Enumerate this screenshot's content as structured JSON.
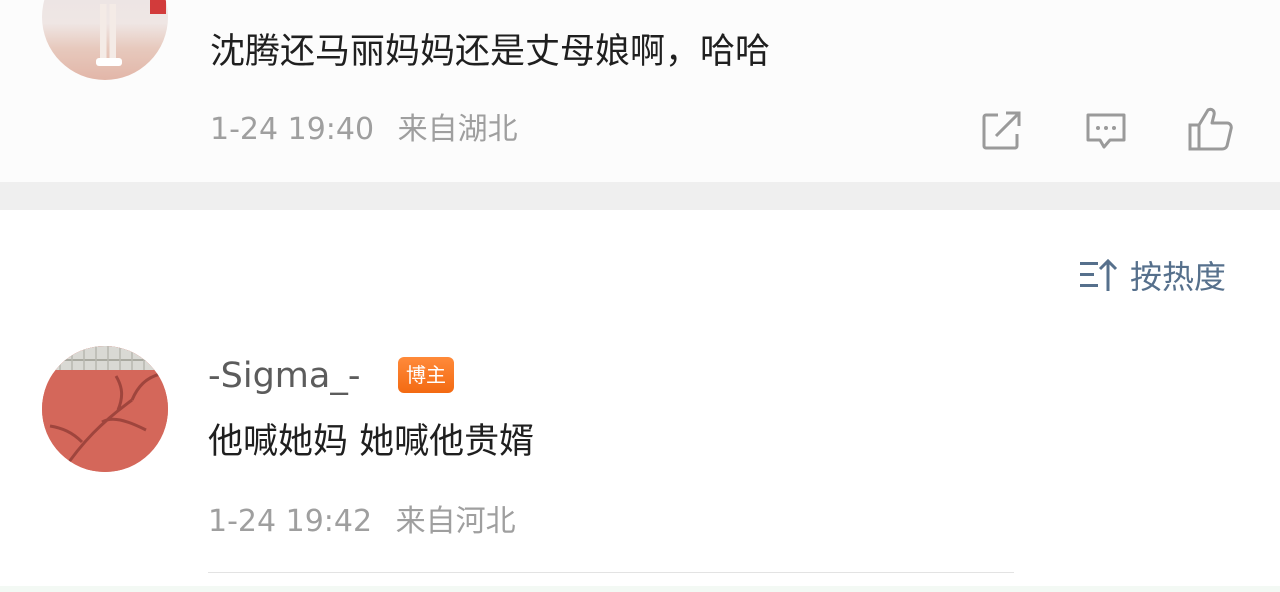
{
  "comment_top": {
    "text": "沈腾还马丽妈妈还是丈母娘啊，哈哈",
    "time": "1-24 19:40",
    "location": "来自湖北",
    "actions": {
      "share": "share-icon",
      "comment": "comment-icon",
      "like": "thumbs-up-icon"
    }
  },
  "sort": {
    "label": "按热度"
  },
  "comment_second": {
    "username": "-Sigma_-",
    "badge": "博主",
    "text": "他喊她妈 她喊他贵婿",
    "time": "1-24 19:42",
    "location": "来自河北"
  },
  "colors": {
    "accent_link": "#56708c",
    "badge_orange": "#f36a12",
    "meta_gray": "#9f9f9f"
  }
}
